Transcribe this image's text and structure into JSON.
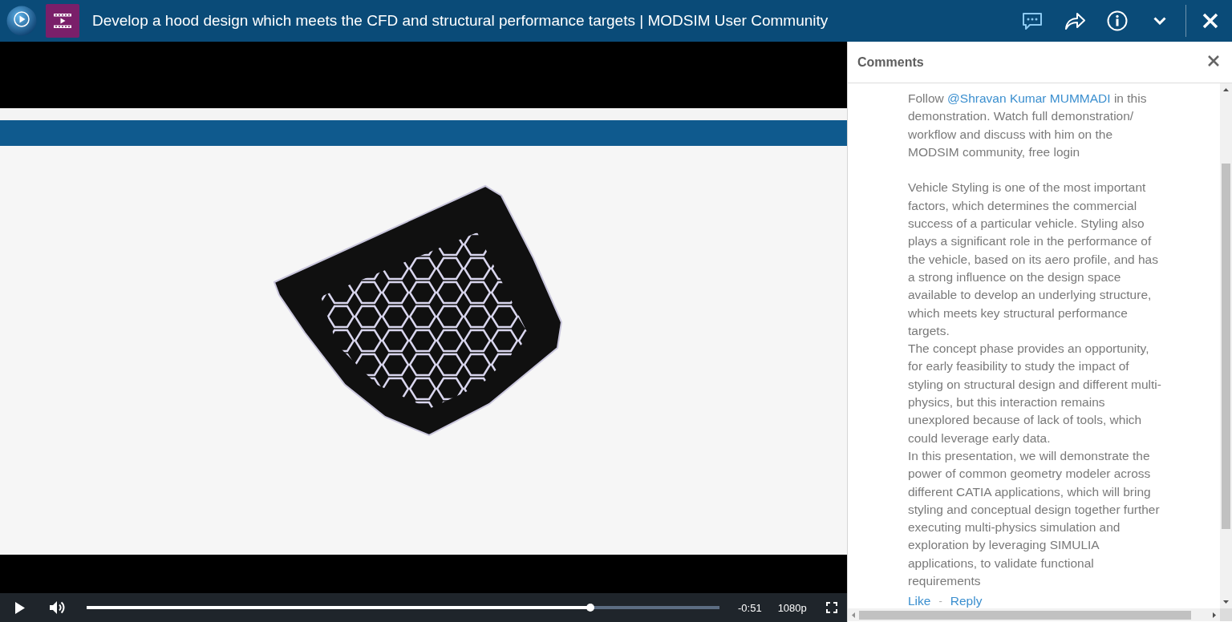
{
  "window": {
    "title": "Develop a hood design which meets the CFD and structural performance targets | MODSIM User Community"
  },
  "player": {
    "playing": false,
    "muted": false,
    "progress": {
      "level": 0.796
    },
    "time_remaining": "-0:51",
    "quality": "1080p"
  },
  "comments_panel": {
    "title": "Comments",
    "comments": [
      {
        "intro": [
          {
            "kind": "text",
            "text": "Follow "
          },
          {
            "kind": "mention",
            "text": "@Shravan Kumar MUMMADI"
          },
          {
            "kind": "text",
            "text": " in this demonstration. Watch full demonstration/ workflow and discuss with him on the MODSIM community, free login"
          }
        ],
        "paragraphs": [
          "Vehicle Styling is one of the most important factors, which determines the commercial success of a particular vehicle. Styling also plays a significant role in the performance of the vehicle, based on its aero profile, and has a strong influence on the design space available to develop an underlying structure, which meets key structural performance targets.",
          "The concept phase provides an opportunity, for early feasibility to study the impact of styling on structural design and different multi-physics, but this interaction remains unexplored because of lack of tools, which could leverage early data.",
          "In this presentation, we will demonstrate the power of common geometry modeler across different CATIA applications, which will bring styling and conceptual design together further executing multi-physics simulation and exploration by leveraging SIMULIA applications, to validate functional requirements"
        ],
        "actions": [
          {
            "label": "Like"
          },
          {
            "label": "Reply"
          }
        ],
        "separator": "-"
      }
    ]
  }
}
